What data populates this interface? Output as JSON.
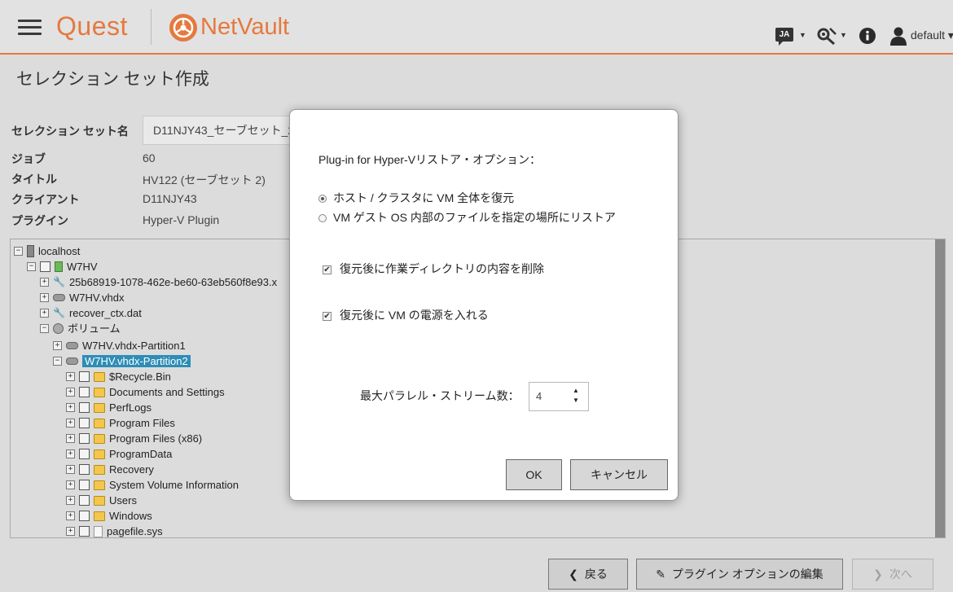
{
  "header": {
    "logo_text": "Quest",
    "product_text": "NetVault",
    "lang_badge": "JA",
    "user": "default"
  },
  "page": {
    "title": "セレクション セット作成",
    "set_name_label": "セレクション セット名",
    "set_name_value": "D11NJY43_セーブセット_2",
    "job_label": "ジョブ",
    "job_value": "60",
    "title_label": "タイトル",
    "title_value": "HV122 (セーブセット 2)",
    "client_label": "クライアント",
    "client_value": "D11NJY43",
    "plugin_label": "プラグイン",
    "plugin_value": "Hyper-V Plugin"
  },
  "tree": {
    "localhost": "localhost",
    "vm": "W7HV",
    "config": "25b68919-1078-462e-be60-63eb560f8e93.x",
    "vhdx": "W7HV.vhdx",
    "ctx": "recover_ctx.dat",
    "volumes": "ボリューム",
    "partition1": "W7HV.vhdx-Partition1",
    "partition2": "W7HV.vhdx-Partition2",
    "folders": [
      "$Recycle.Bin",
      "Documents and Settings",
      "PerfLogs",
      "Program Files",
      "Program Files (x86)",
      "ProgramData",
      "Recovery",
      "System Volume Information",
      "Users",
      "Windows"
    ],
    "file": "pagefile.sys"
  },
  "buttons": {
    "back": "戻る",
    "edit_plugin": "プラグイン オプションの編集",
    "next": "次へ"
  },
  "modal": {
    "heading": "Plug-in for Hyper-Vリストア・オプション：",
    "radio_full": "ホスト / クラスタに VM 全体を復元",
    "radio_files": "VM ゲスト OS 内部のファイルを指定の場所にリストア",
    "check_delete": "復元後に作業ディレクトリの内容を削除",
    "check_power": "復元後に VM の電源を入れる",
    "streams_label": "最大パラレル・ストリーム数：",
    "streams_value": "4",
    "ok": "OK",
    "cancel": "キャンセル"
  }
}
